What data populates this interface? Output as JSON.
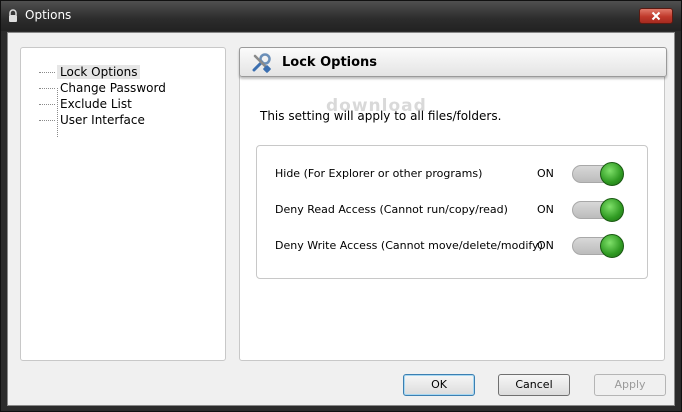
{
  "window": {
    "title": "Options",
    "icons": {
      "app": "lock-icon",
      "close": "close-icon"
    }
  },
  "sidebar": {
    "items": [
      {
        "label": "Lock Options",
        "selected": true
      },
      {
        "label": "Change Password",
        "selected": false
      },
      {
        "label": "Exclude List",
        "selected": false
      },
      {
        "label": "User Interface",
        "selected": false
      }
    ]
  },
  "content": {
    "header": {
      "title": "Lock Options",
      "icon": "tools-icon"
    },
    "info": "This setting will apply to all files/folders.",
    "options": [
      {
        "label": "Hide (For Explorer or other programs)",
        "state": "ON"
      },
      {
        "label": "Deny Read Access (Cannot run/copy/read)",
        "state": "ON"
      },
      {
        "label": "Deny Write Access (Cannot move/delete/modify)",
        "state": "ON"
      }
    ],
    "watermark": "download"
  },
  "buttons": {
    "ok": "OK",
    "cancel": "Cancel",
    "apply": "Apply"
  },
  "colors": {
    "toggle_on": "#2f9a22",
    "titlebar": "#2c2c2c"
  }
}
